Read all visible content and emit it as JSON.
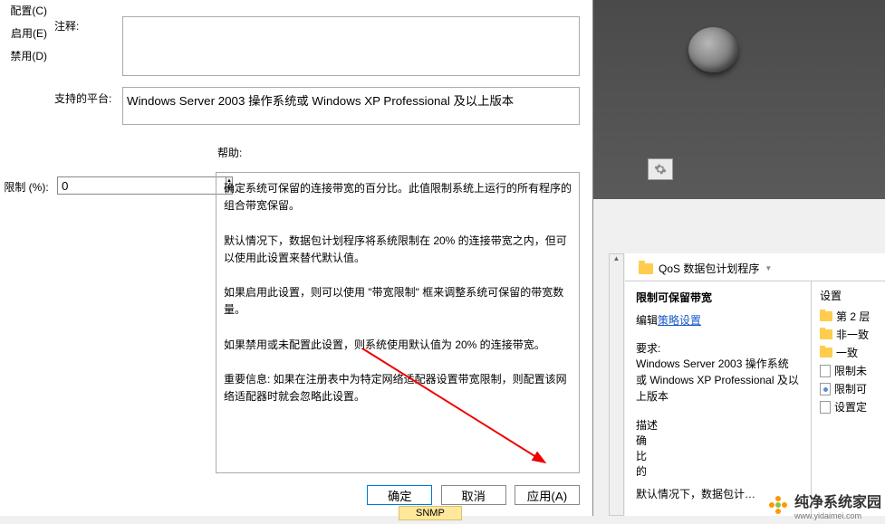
{
  "left_menu": {
    "config": "配置(C)",
    "enable": "启用(E)",
    "disable": "禁用(D)"
  },
  "labels": {
    "comment": "注释:",
    "platform": "支持的平台:",
    "help": "帮助:",
    "limit": "限制 (%):"
  },
  "values": {
    "platform": "Windows Server 2003 操作系统或 Windows XP Professional 及以上版本",
    "limit": "0",
    "help": "确定系统可保留的连接带宽的百分比。此值限制系统上运行的所有程序的组合带宽保留。\n\n默认情况下，数据包计划程序将系统限制在 20% 的连接带宽之内，但可以使用此设置来替代默认值。\n\n如果启用此设置，则可以使用 \"带宽限制\" 框来调整系统可保留的带宽数量。\n\n如果禁用或未配置此设置，则系统使用默认值为 20% 的连接带宽。\n\n重要信息: 如果在注册表中为特定网络适配器设置带宽限制，则配置该网络适配器时就会忽略此设置。"
  },
  "buttons": {
    "ok": "确定",
    "cancel": "取消",
    "apply": "应用(A)"
  },
  "snmp": "SNMP",
  "window2": {
    "crumb": "QoS 数据包计划程序",
    "title": "限制可保留带宽",
    "edit_link_pre": "编辑",
    "edit_link": "策略设置",
    "req_label": "要求:",
    "req_text": "Windows Server 2003 操作系统或 Windows XP Professional 及以上版本",
    "desc_label": "描述",
    "desc_l1": "确",
    "desc_l2": "比",
    "desc_l3": "的",
    "desc_tail": "默认情况下，数据包计…",
    "settings_hdr": "设置",
    "items": [
      "第 2 层",
      "非一致",
      "一致",
      "限制未",
      "限制可",
      "设置定"
    ]
  },
  "watermark": {
    "main": "纯净系统家园",
    "sub": "www.yidaimei.com"
  }
}
